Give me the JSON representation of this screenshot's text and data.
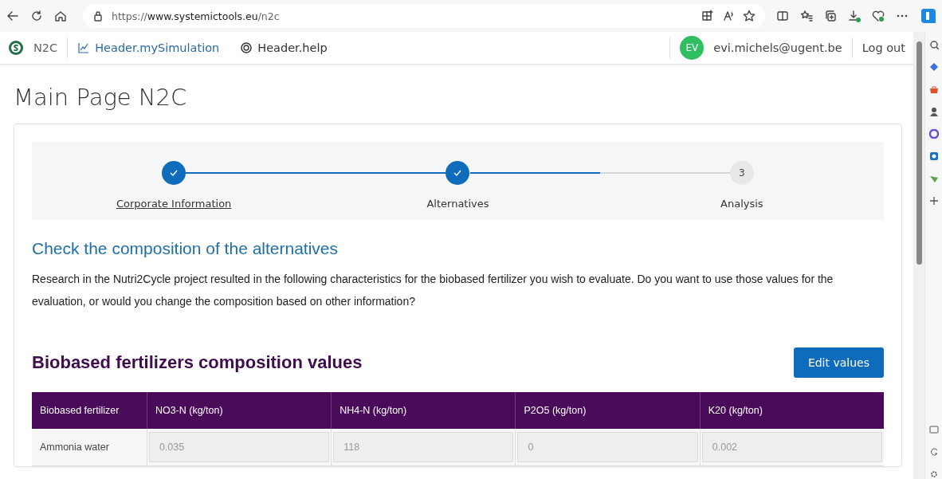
{
  "browser": {
    "url_scheme": "https://",
    "url_host": "www.systemictools.eu",
    "url_path": "/n2c"
  },
  "header": {
    "brand": "N2C",
    "nav": [
      {
        "label": "Header.mySimulation",
        "kind": "chart"
      },
      {
        "label": "Header.help",
        "kind": "help"
      }
    ],
    "avatar": "EV",
    "user": "evi.michels@ugent.be",
    "logout": "Log out"
  },
  "page_title": "Main Page N2C",
  "stepper": {
    "steps": [
      {
        "label": "Corporate Information",
        "done": true,
        "link": true
      },
      {
        "label": "Alternatives",
        "done": true,
        "link": false
      },
      {
        "label": "Analysis",
        "done": false,
        "link": false,
        "number": "3"
      }
    ],
    "connectors": [
      {
        "level": 1
      },
      {
        "level": 0.5
      }
    ]
  },
  "section": {
    "heading": "Check the composition of the alternatives",
    "text": "Research in the Nutri2Cycle project resulted in the following characteristics for the biobased fertilizer you wish to evaluate. Do you want to use those values for the evaluation, or would you change the composition based on other information?"
  },
  "composition": {
    "title": "Biobased fertilizers composition values",
    "edit_button": "Edit values",
    "columns": [
      "Biobased fertilizer",
      "NO3-N (kg/ton)",
      "NH4-N (kg/ton)",
      "P2O5 (kg/ton)",
      "K20 (kg/ton)"
    ],
    "rows": [
      {
        "name": "Ammonia water",
        "values": [
          "0.035",
          "118",
          "0",
          "0.002"
        ],
        "disabled": true
      }
    ]
  }
}
